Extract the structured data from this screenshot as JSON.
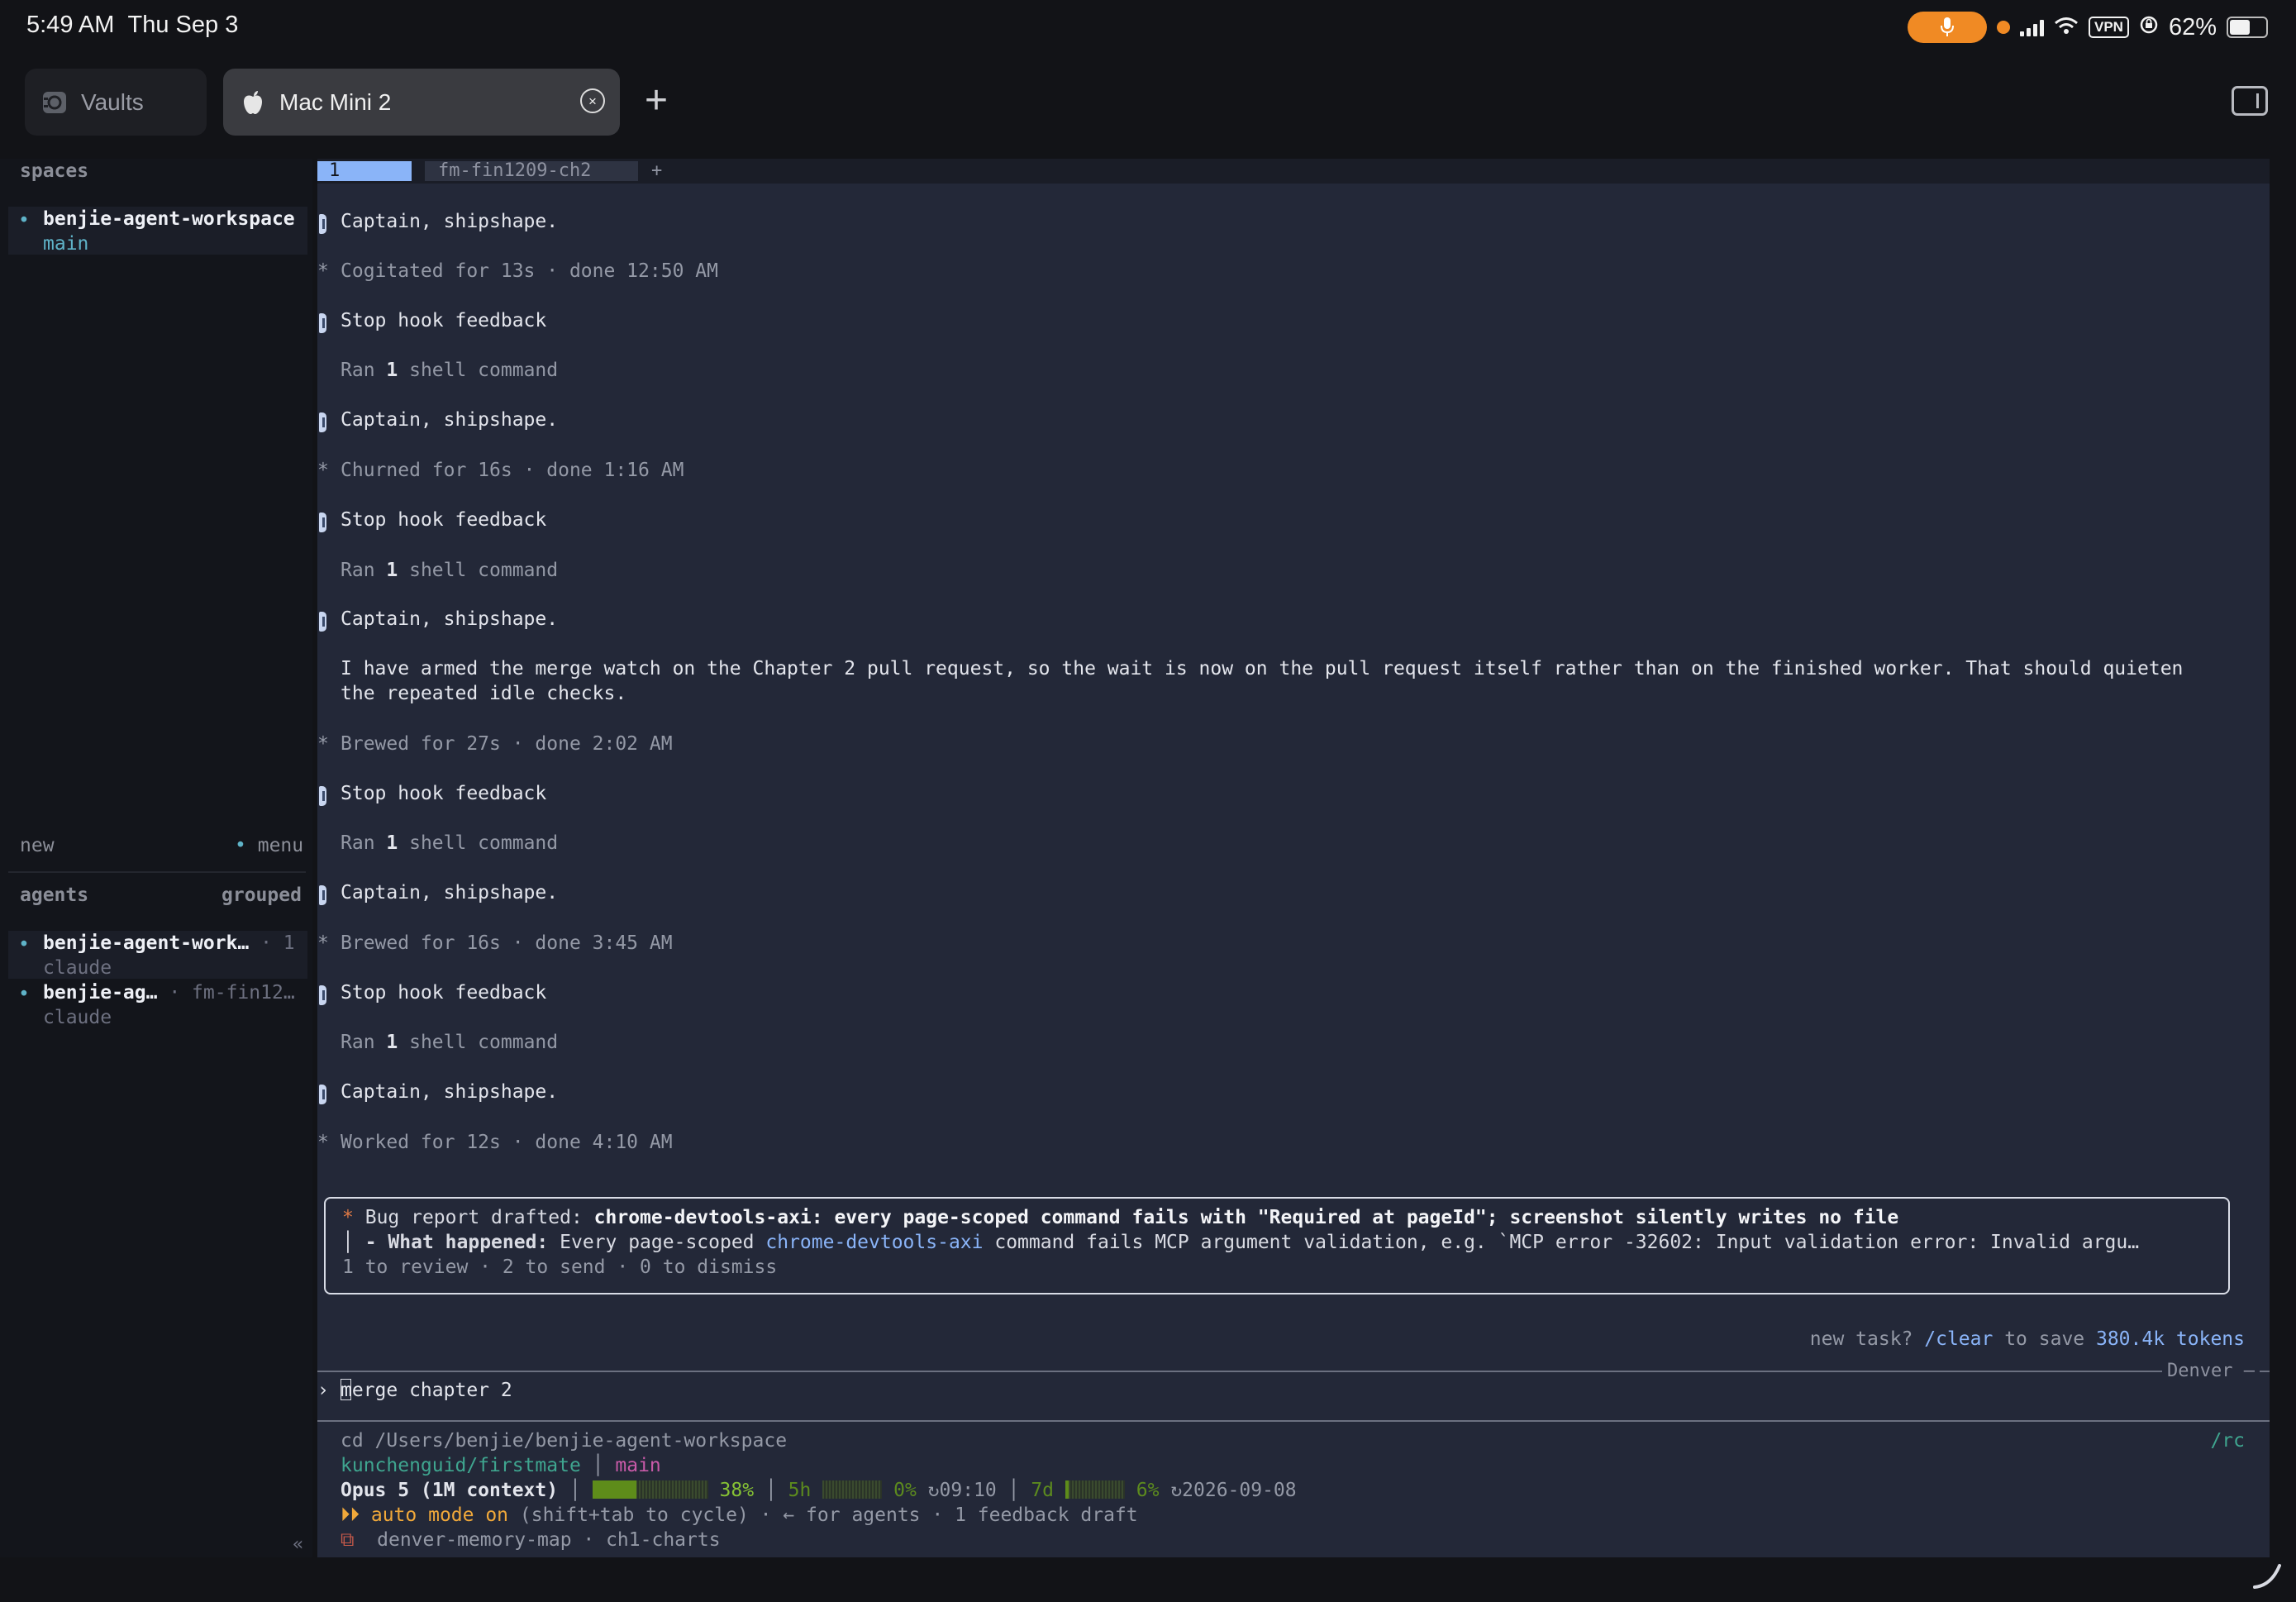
{
  "status_bar": {
    "time": "5:49 AM",
    "date": "Thu Sep 3",
    "battery": "62%",
    "vpn": "VPN",
    "battery_level": 0.62
  },
  "tabs": [
    {
      "label": "Vaults",
      "icon": "vault-icon"
    },
    {
      "label": "Mac Mini 2",
      "icon": "apple-icon"
    }
  ],
  "sidebar": {
    "spaces_header": "spaces",
    "space": {
      "name": "benjie-agent-workspace",
      "branch": "main"
    },
    "new_label": "new",
    "menu_label": "menu",
    "agents_header": "agents",
    "grouped_label": "grouped",
    "agents": [
      {
        "name": "benjie-agent-work…",
        "extra": "· 1",
        "type": "claude"
      },
      {
        "name": "benjie-ag…",
        "extra": "· fm-fin12…",
        "type": "claude"
      }
    ],
    "collapse_glyph": "«"
  },
  "terminal": {
    "tabs": [
      {
        "label": "1"
      },
      {
        "label": "fm-fin1209-ch2"
      }
    ],
    "new_tab": "+",
    "lines": {
      "l1": "Captain, shipshape.",
      "l2": "Cogitated for 13s · done 12:50 AM",
      "l3": "Stop hook feedback",
      "l4a": "Ran ",
      "l4b": "1",
      "l4c": " shell command",
      "l5": "Captain, shipshape.",
      "l6": "Churned for 16s · done 1:16 AM",
      "l7": "Stop hook feedback",
      "l8a": "Ran ",
      "l8b": "1",
      "l8c": " shell command",
      "l9": "Captain, shipshape.",
      "l10": "I have armed the merge watch on the Chapter 2 pull request, so the wait is now on the pull request itself rather than on the finished worker. That should quieten",
      "l11": "the repeated idle checks.",
      "l12": "Brewed for 27s · done 2:02 AM",
      "l13": "Stop hook feedback",
      "l14a": "Ran ",
      "l14b": "1",
      "l14c": " shell command",
      "l15": "Captain, shipshape.",
      "l16": "Brewed for 16s · done 3:45 AM",
      "l17": "Stop hook feedback",
      "l18a": "Ran ",
      "l18b": "1",
      "l18c": " shell command",
      "l19": "Captain, shipshape.",
      "l20": "Worked for 12s · done 4:10 AM"
    },
    "star": "*",
    "bug_report": {
      "star": "*",
      "prefix": "Bug report drafted: ",
      "title": "chrome-devtools-axi: every page-scoped command fails with \"Required at pageId\"; screenshot silently writes no file",
      "pipe": "│",
      "what_label": "- What happened:",
      "what_a": " Every page-scoped ",
      "what_b": "chrome-devtools-axi",
      "what_c": " command fails MCP argument validation, e.g. `MCP error -32602: Input validation error: Invalid argu…",
      "actions": "1 to review · 2 to send · 0 to dismiss"
    },
    "hint_a": "new task? ",
    "hint_b": "/clear",
    "hint_c": " to save ",
    "hint_d": "380.4k tokens",
    "location": "Denver —",
    "prompt_glyph": "›",
    "input_value": "merge chapter 2",
    "footer": {
      "cd": "cd /Users/benjie/benjie-agent-workspace",
      "rc": "/rc",
      "repo": "kunchenguid/firstmate",
      "branch_sep": "│",
      "branch": "main",
      "model": "Opus 5 (1M context)",
      "sep": "│",
      "ctx_pct": "38%",
      "ctx_level": 0.38,
      "h5_label": "5h",
      "h5_pct": "0%",
      "h5_level": 0,
      "h5_reset": "↻09:10",
      "d7_label": "7d",
      "d7_pct": "6%",
      "d7_level": 0.06,
      "d7_reset": "↻2026-09-08",
      "auto_glyph": "⏵⏵",
      "auto_on": "auto mode on",
      "auto_rest": " (shift+tab to cycle) · ← for agents · 1 feedback draft",
      "task_glyph": "⧉",
      "tasks": "denver-memory-map · ch1-charts"
    }
  }
}
